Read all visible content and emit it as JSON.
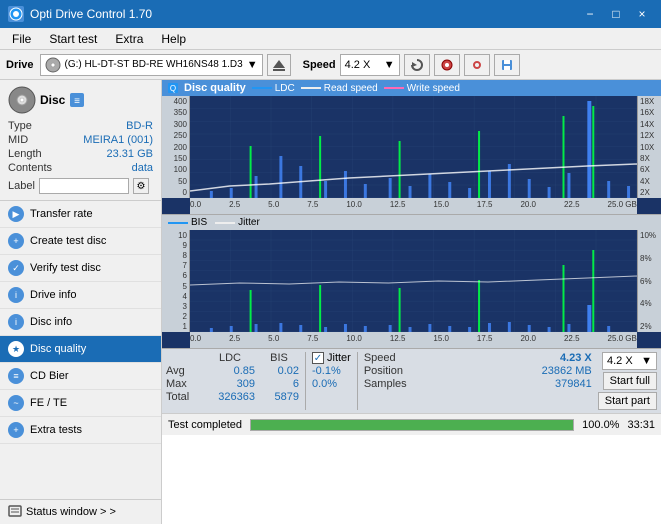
{
  "app": {
    "title": "Opti Drive Control 1.70",
    "icon": "ODC"
  },
  "titlebar": {
    "minimize": "−",
    "maximize": "□",
    "close": "×"
  },
  "menubar": {
    "items": [
      "File",
      "Start test",
      "Extra",
      "Help"
    ]
  },
  "toolbar": {
    "drive_label": "Drive",
    "drive_icon": "💿",
    "drive_name": "(G:)  HL-DT-ST BD-RE  WH16NS48 1.D3",
    "speed_label": "Speed",
    "speed_value": "4.2 X"
  },
  "sidebar": {
    "disc_title": "Disc",
    "disc_type_label": "Type",
    "disc_type_value": "BD-R",
    "disc_mid_label": "MID",
    "disc_mid_value": "MEIRA1 (001)",
    "disc_length_label": "Length",
    "disc_length_value": "23.31 GB",
    "disc_contents_label": "Contents",
    "disc_contents_value": "data",
    "disc_label_label": "Label",
    "disc_label_value": "",
    "menu_items": [
      {
        "id": "transfer-rate",
        "label": "Transfer rate",
        "icon": "▶"
      },
      {
        "id": "create-test-disc",
        "label": "Create test disc",
        "icon": "+"
      },
      {
        "id": "verify-test-disc",
        "label": "Verify test disc",
        "icon": "✓"
      },
      {
        "id": "drive-info",
        "label": "Drive info",
        "icon": "i"
      },
      {
        "id": "disc-info",
        "label": "Disc info",
        "icon": "i"
      },
      {
        "id": "disc-quality",
        "label": "Disc quality",
        "icon": "★",
        "active": true
      },
      {
        "id": "cd-bier",
        "label": "CD Bier",
        "icon": "≡"
      },
      {
        "id": "fe-te",
        "label": "FE / TE",
        "icon": "~"
      },
      {
        "id": "extra-tests",
        "label": "Extra tests",
        "icon": "+"
      }
    ],
    "status_window": "Status window > >"
  },
  "chart1": {
    "title": "Disc quality",
    "legend": {
      "ldc": "LDC",
      "read_speed": "Read speed",
      "write_speed": "Write speed"
    },
    "y_left": [
      "400",
      "350",
      "300",
      "250",
      "200",
      "150",
      "100",
      "50",
      "0"
    ],
    "y_right": [
      "18X",
      "16X",
      "14X",
      "12X",
      "10X",
      "8X",
      "6X",
      "4X",
      "2X"
    ],
    "x_axis": [
      "0.0",
      "2.5",
      "5.0",
      "7.5",
      "10.0",
      "12.5",
      "15.0",
      "17.5",
      "20.0",
      "22.5",
      "25.0 GB"
    ]
  },
  "chart2": {
    "legend": {
      "bis": "BIS",
      "jitter": "Jitter"
    },
    "y_left": [
      "10",
      "9",
      "8",
      "7",
      "6",
      "5",
      "4",
      "3",
      "2",
      "1"
    ],
    "y_right": [
      "10%",
      "8%",
      "6%",
      "4%",
      "2%"
    ],
    "x_axis": [
      "0.0",
      "2.5",
      "5.0",
      "7.5",
      "10.0",
      "12.5",
      "15.0",
      "17.5",
      "20.0",
      "22.5",
      "25.0 GB"
    ]
  },
  "stats": {
    "ldc_header": "LDC",
    "bis_header": "BIS",
    "jitter_header": "Jitter",
    "speed_header": "Speed",
    "avg_label": "Avg",
    "max_label": "Max",
    "total_label": "Total",
    "ldc_avg": "0.85",
    "ldc_max": "309",
    "ldc_total": "326363",
    "bis_avg": "0.02",
    "bis_max": "6",
    "bis_total": "5879",
    "jitter_avg": "-0.1%",
    "jitter_max": "0.0%",
    "speed_val": "4.23 X",
    "position_label": "Position",
    "position_val": "23862 MB",
    "samples_label": "Samples",
    "samples_val": "379841",
    "speed_select": "4.2 X",
    "start_full": "Start full",
    "start_part": "Start part"
  },
  "bottom": {
    "status_text": "Test completed",
    "progress": 100,
    "time": "33:31"
  }
}
